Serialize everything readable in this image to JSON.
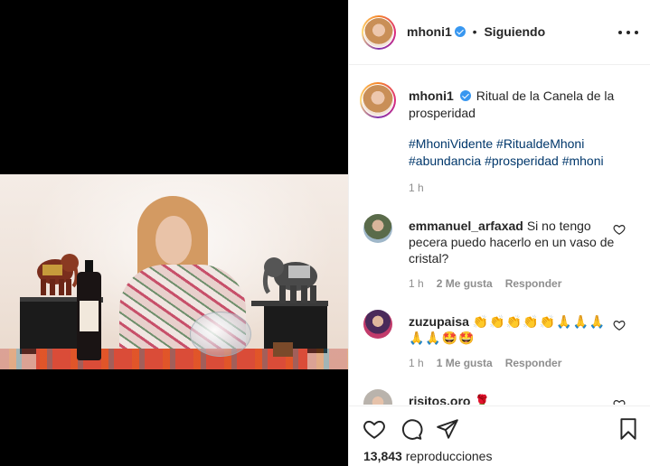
{
  "post": {
    "username": "mhoni1",
    "follow_status": "Siguiendo",
    "separator": "•",
    "caption": "Ritual de la Canela de la prosperidad",
    "hashtags": "#MhoniVidente #RitualdeMhoni #abundancia #prosperidad #mhoni",
    "caption_time": "1 h",
    "views_count": "13,843",
    "views_label": "reproducciones"
  },
  "comments": [
    {
      "username": "emmanuel_arfaxad",
      "text": "Si no tengo pecera puedo hacerlo en un vaso de cristal?",
      "time": "1 h",
      "likes": "2 Me gusta",
      "reply": "Responder"
    },
    {
      "username": "zuzupaisa",
      "text": "👏👏👏👏👏🙏🙏🙏🙏🙏🤩🤩",
      "time": "1 h",
      "likes": "1 Me gusta",
      "reply": "Responder"
    },
    {
      "username": "risitos.oro",
      "text": "🌹",
      "time": "",
      "likes": "",
      "reply": ""
    }
  ],
  "colors": {
    "link": "#00376b",
    "verified": "#3897f0",
    "muted": "#8e8e8e",
    "text": "#262626"
  },
  "icons": [
    "more-options-icon",
    "verified-icon",
    "heart-icon",
    "comment-icon",
    "share-icon",
    "save-icon"
  ]
}
